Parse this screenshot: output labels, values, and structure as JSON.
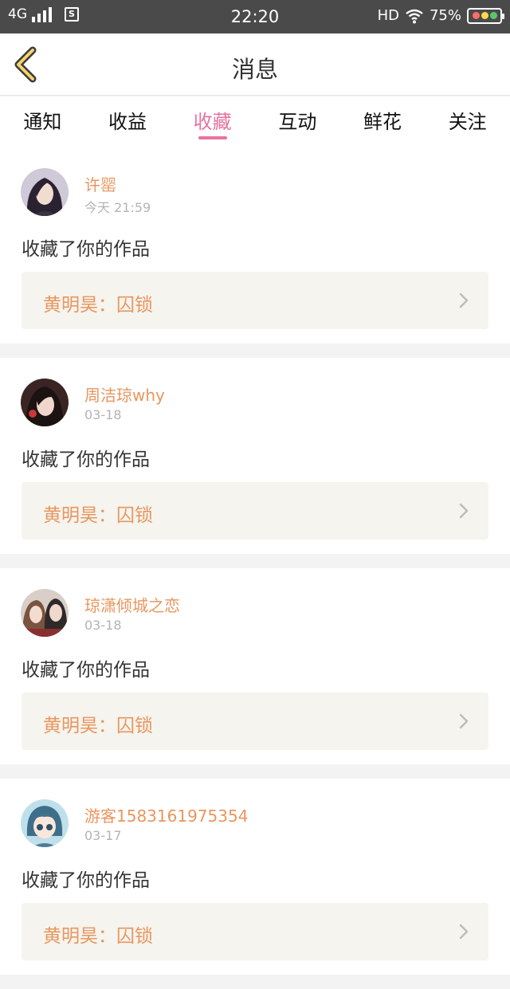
{
  "status_bar": {
    "network": "4G",
    "sim_label": "S",
    "time": "22:20",
    "hd": "HD",
    "battery_percent": "75%"
  },
  "header": {
    "title": "消息",
    "back_icon": "chevron-left-icon"
  },
  "tabs": [
    {
      "label": "通知",
      "active": false
    },
    {
      "label": "收益",
      "active": false
    },
    {
      "label": "收藏",
      "active": true
    },
    {
      "label": "互动",
      "active": false
    },
    {
      "label": "鲜花",
      "active": false
    },
    {
      "label": "关注",
      "active": false
    }
  ],
  "colors": {
    "accent_pink": "#e8739e",
    "name_orange": "#e8965f",
    "card_bg": "#f5f4ee",
    "status_bar": "#4a4a4a"
  },
  "items": [
    {
      "user": "许罂",
      "date": "今天 21:59",
      "message": "收藏了你的作品",
      "work": "黄明昊：囚锁"
    },
    {
      "user": "周洁琼why",
      "date": "03-18",
      "message": "收藏了你的作品",
      "work": "黄明昊：囚锁"
    },
    {
      "user": "琼潇倾城之恋",
      "date": "03-18",
      "message": "收藏了你的作品",
      "work": "黄明昊：囚锁"
    },
    {
      "user": "游客1583161975354",
      "date": "03-17",
      "message": "收藏了你的作品",
      "work": "黄明昊：囚锁"
    }
  ]
}
